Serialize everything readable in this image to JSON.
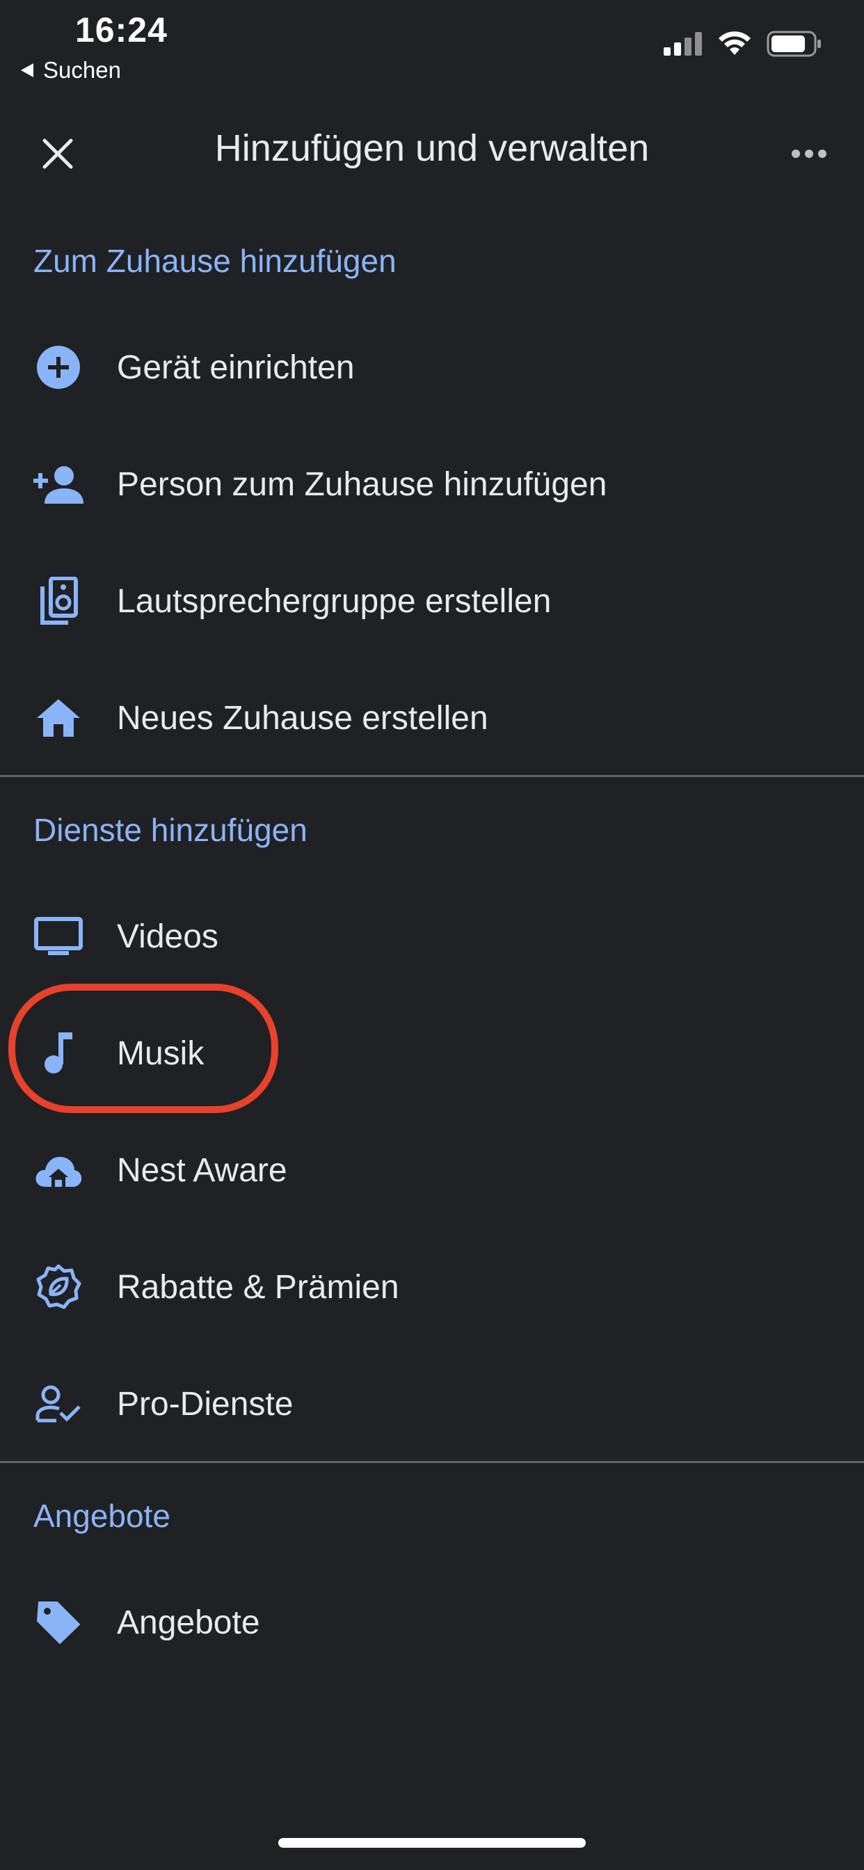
{
  "status_bar": {
    "time": "16:24",
    "back_label": "Suchen"
  },
  "header": {
    "title": "Hinzufügen und verwalten"
  },
  "sections": {
    "home": {
      "title": "Zum Zuhause hinzufügen",
      "items": [
        {
          "label": "Gerät einrichten",
          "icon": "add-circle-icon"
        },
        {
          "label": "Person zum Zuhause hinzufügen",
          "icon": "person-add-icon"
        },
        {
          "label": "Lautsprechergruppe erstellen",
          "icon": "speaker-group-icon"
        },
        {
          "label": "Neues Zuhause erstellen",
          "icon": "home-icon"
        }
      ]
    },
    "services": {
      "title": "Dienste hinzufügen",
      "items": [
        {
          "label": "Videos",
          "icon": "tv-icon"
        },
        {
          "label": "Musik",
          "icon": "music-note-icon"
        },
        {
          "label": "Nest Aware",
          "icon": "nest-aware-icon"
        },
        {
          "label": "Rabatte & Prämien",
          "icon": "rewards-badge-icon"
        },
        {
          "label": "Pro-Dienste",
          "icon": "pro-services-icon"
        }
      ]
    },
    "offers": {
      "title": "Angebote",
      "items": [
        {
          "label": "Angebote",
          "icon": "tag-icon"
        }
      ]
    }
  },
  "colors": {
    "background": "#202124",
    "accent": "#8ab4f8",
    "text": "#e8eaed",
    "highlight": "#e8412c"
  }
}
